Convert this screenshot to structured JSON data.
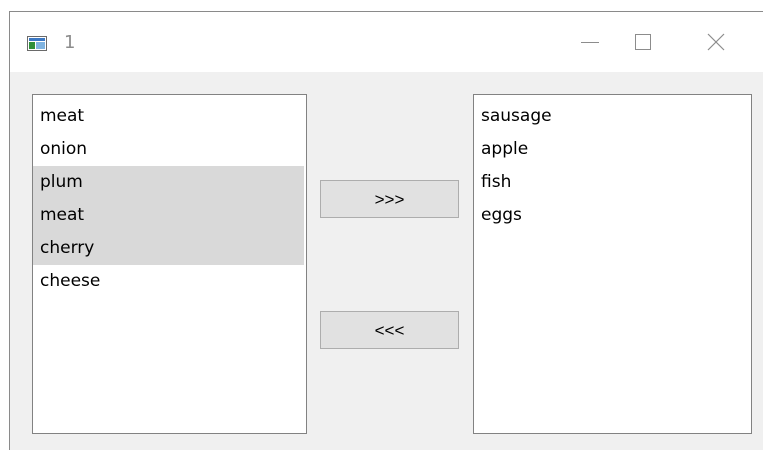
{
  "window": {
    "title": "1",
    "icon": "window-app-icon",
    "controls": [
      "minimize-icon",
      "maximize-icon",
      "close-icon"
    ]
  },
  "left_list": {
    "items": [
      {
        "label": "meat",
        "selected": false
      },
      {
        "label": "onion",
        "selected": false
      },
      {
        "label": "plum",
        "selected": true
      },
      {
        "label": "meat",
        "selected": true
      },
      {
        "label": "cherry",
        "selected": true
      },
      {
        "label": "cheese",
        "selected": false
      }
    ]
  },
  "right_list": {
    "items": [
      {
        "label": "sausage",
        "selected": false
      },
      {
        "label": "apple",
        "selected": false
      },
      {
        "label": "fish",
        "selected": false
      },
      {
        "label": "eggs",
        "selected": false
      }
    ]
  },
  "buttons": {
    "move_right_label": ">>>",
    "move_left_label": "<<<"
  },
  "colors": {
    "selection": "#d9d9d9",
    "window_bg": "#f0f0f0",
    "button_bg": "#e1e1e1"
  }
}
